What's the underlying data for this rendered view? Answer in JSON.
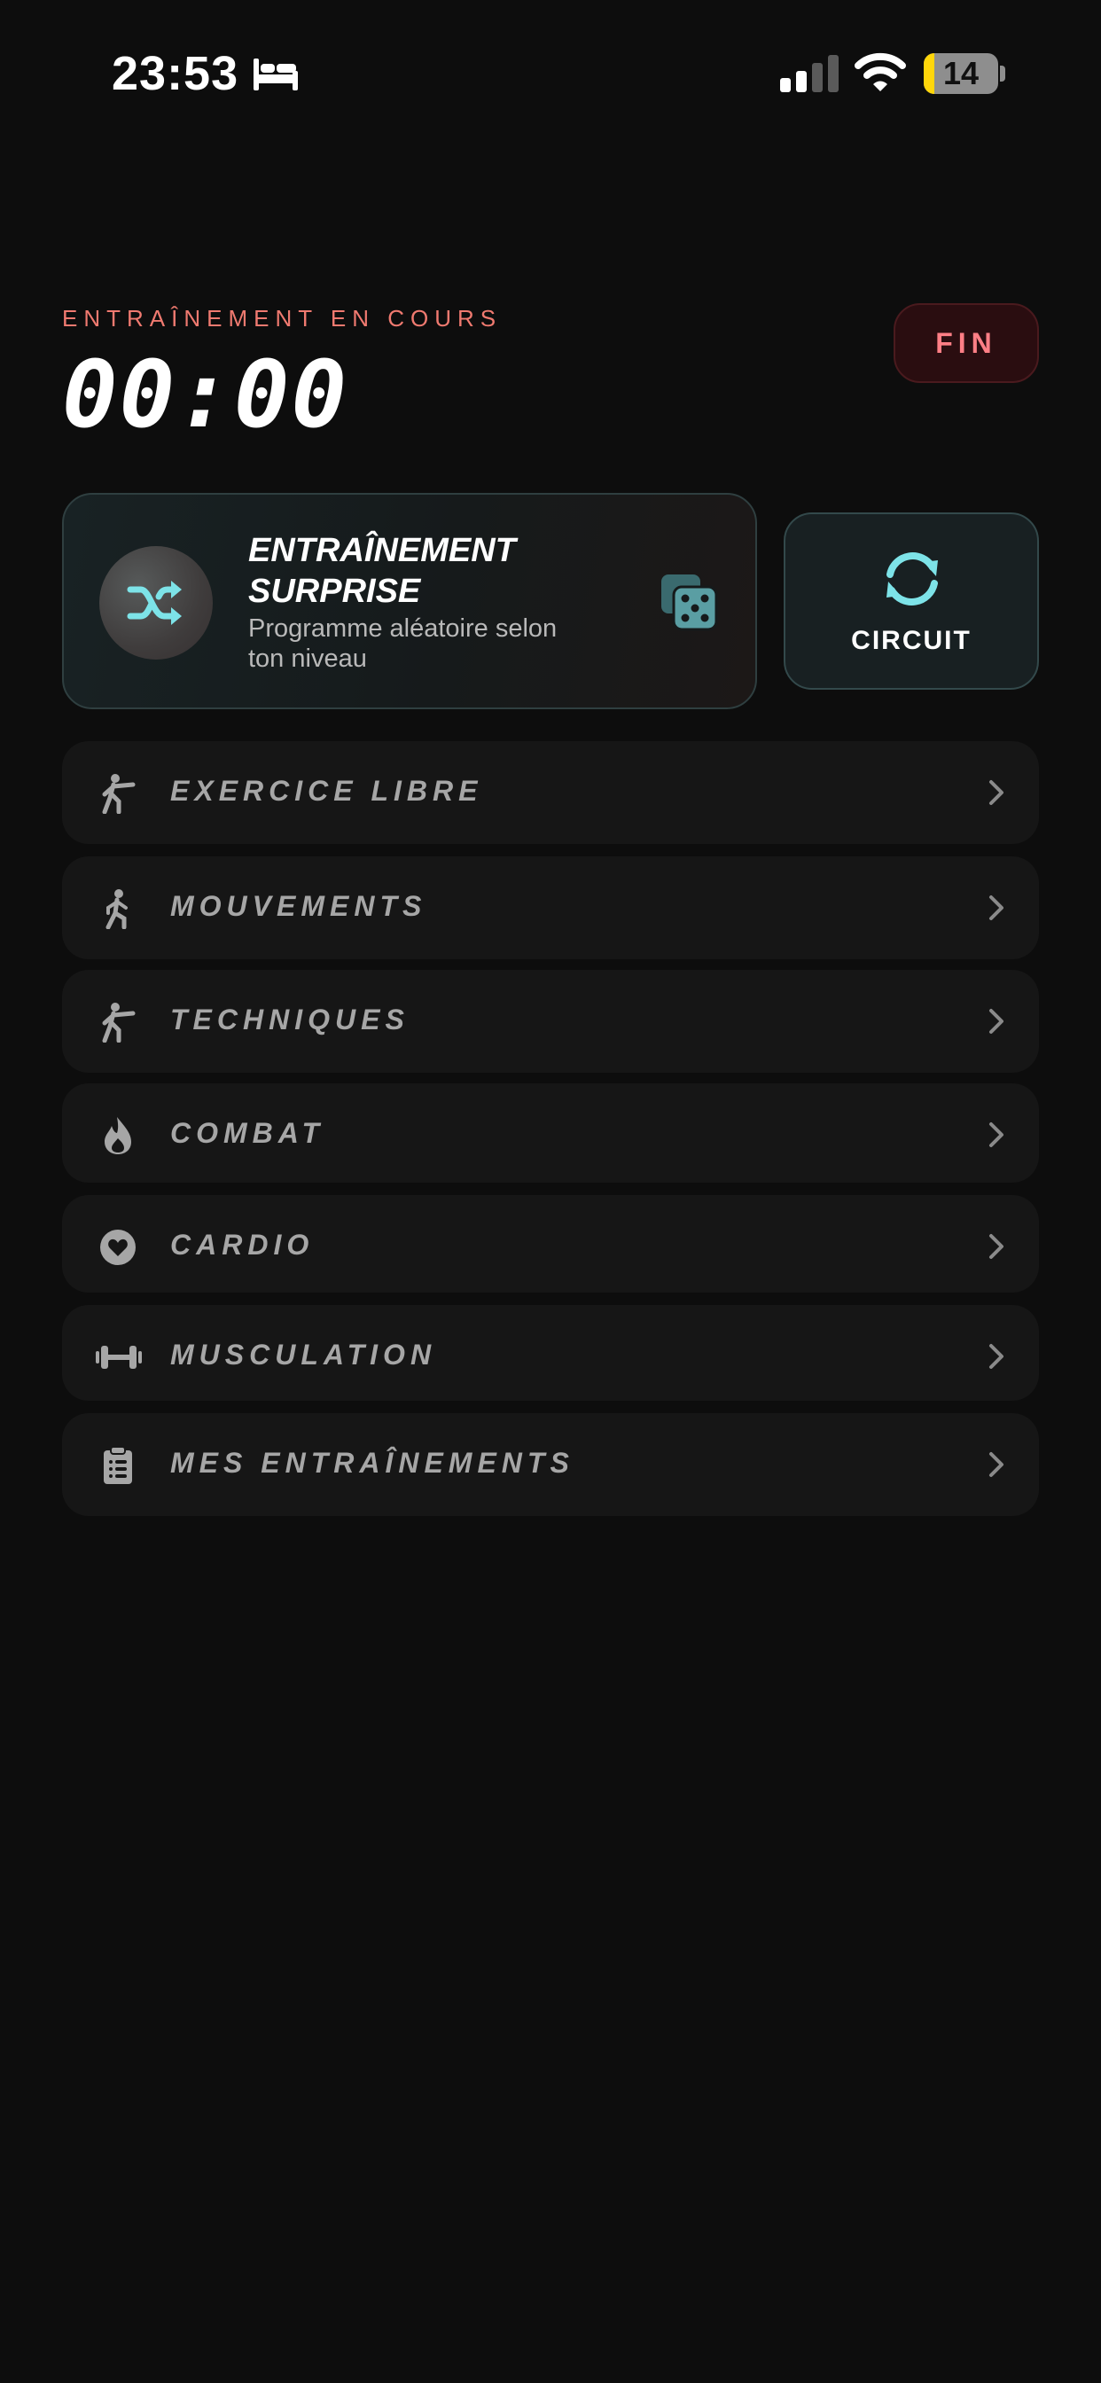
{
  "status_bar": {
    "time": "23:53",
    "battery_level": "14",
    "battery_percent": 14,
    "icons": [
      "bed-icon",
      "cellular-signal-icon",
      "wifi-icon",
      "battery-icon"
    ]
  },
  "session": {
    "label": "ENTRAÎNEMENT EN COURS",
    "timer": "00:00",
    "end_button": "FIN"
  },
  "surprise": {
    "title": "ENTRAÎNEMENT SURPRISE",
    "subtitle": "Programme aléatoire selon ton niveau",
    "icons": [
      "shuffle-icon",
      "dice-icon"
    ]
  },
  "circuit": {
    "label": "CIRCUIT",
    "icon": "refresh-icon"
  },
  "menu": [
    {
      "label": "EXERCICE LIBRE",
      "icon": "figure-kick-icon"
    },
    {
      "label": "MOUVEMENTS",
      "icon": "figure-walk-icon"
    },
    {
      "label": "TECHNIQUES",
      "icon": "figure-kick-icon"
    },
    {
      "label": "COMBAT",
      "icon": "flame-icon"
    },
    {
      "label": "CARDIO",
      "icon": "heart-circle-icon"
    },
    {
      "label": "MUSCULATION",
      "icon": "dumbbell-icon"
    },
    {
      "label": "MES ENTRAÎNEMENTS",
      "icon": "clipboard-list-icon"
    }
  ],
  "colors": {
    "background": "#0d0d0d",
    "accent_cyan": "#7de3e8",
    "accent_red": "#f07a70",
    "menu_text": "#a6a6a6",
    "battery_yellow": "#ffd60a"
  }
}
